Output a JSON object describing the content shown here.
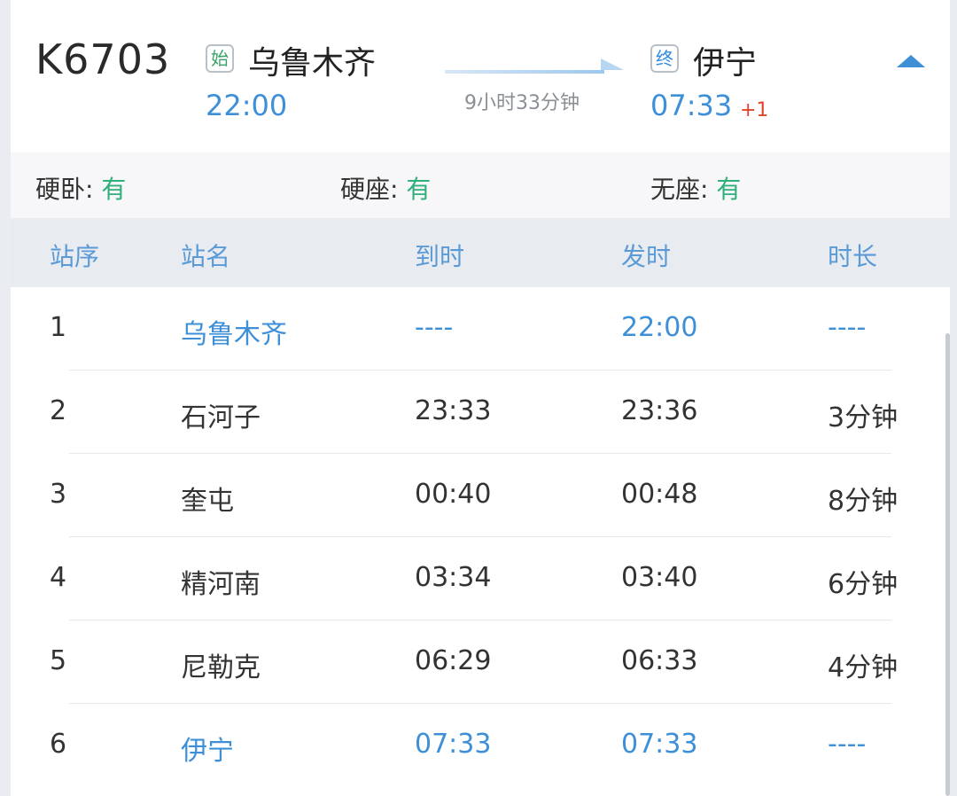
{
  "header": {
    "train_no": "K6703",
    "start_badge": "始",
    "end_badge": "终",
    "from_station": "乌鲁木齐",
    "to_station": "伊宁",
    "depart_time": "22:00",
    "arrive_time": "07:33",
    "day_offset": "+1",
    "duration": "9小时33分钟"
  },
  "seats": [
    {
      "label": "硬卧: ",
      "value": "有"
    },
    {
      "label": "硬座: ",
      "value": "有"
    },
    {
      "label": "无座: ",
      "value": "有"
    }
  ],
  "table": {
    "headers": [
      "站序",
      "站名",
      "到时",
      "发时",
      "时长"
    ],
    "rows": [
      {
        "no": "1",
        "station": "乌鲁木齐",
        "arrive": "----",
        "depart": "22:00",
        "stay": "----"
      },
      {
        "no": "2",
        "station": "石河子",
        "arrive": "23:33",
        "depart": "23:36",
        "stay": "3分钟"
      },
      {
        "no": "3",
        "station": "奎屯",
        "arrive": "00:40",
        "depart": "00:48",
        "stay": "8分钟"
      },
      {
        "no": "4",
        "station": "精河南",
        "arrive": "03:34",
        "depart": "03:40",
        "stay": "6分钟"
      },
      {
        "no": "5",
        "station": "尼勒克",
        "arrive": "06:29",
        "depart": "06:33",
        "stay": "4分钟"
      },
      {
        "no": "6",
        "station": "伊宁",
        "arrive": "07:33",
        "depart": "07:33",
        "stay": "----"
      }
    ]
  },
  "colors": {
    "accent": "#3d8fd8",
    "available": "#2fb07a",
    "day_offset": "#e0442a"
  }
}
